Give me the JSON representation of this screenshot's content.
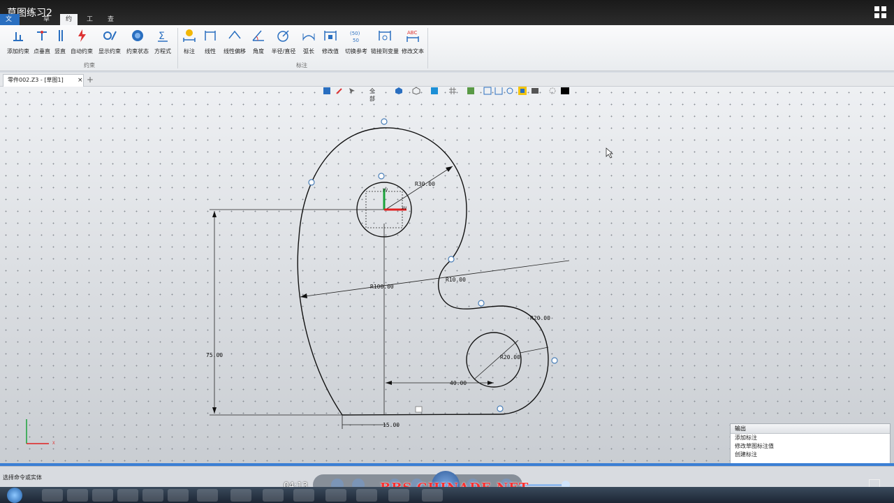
{
  "window": {
    "title": "草图练习2"
  },
  "ribbon_tabs": [
    {
      "label": "文件(F)"
    },
    {
      "label": "草图"
    },
    {
      "label": "约束"
    },
    {
      "label": "工具"
    },
    {
      "label": "查询"
    }
  ],
  "ribbon_buttons": [
    {
      "label": "添加约束",
      "icon": "add-constraint-icon"
    },
    {
      "label": "点垂直",
      "icon": "point-perpendicular-icon"
    },
    {
      "label": "竖直",
      "icon": "vertical-icon"
    },
    {
      "label": "自动约束",
      "icon": "auto-constraint-icon"
    },
    {
      "label": "显示约束",
      "icon": "show-constraint-icon"
    },
    {
      "label": "约束状态",
      "icon": "constraint-status-icon"
    },
    {
      "label": "方程式",
      "icon": "equation-icon"
    },
    {
      "label": "标注",
      "icon": "dimension-icon"
    },
    {
      "label": "线性",
      "icon": "linear-icon"
    },
    {
      "label": "线性偏移",
      "icon": "linear-offset-icon"
    },
    {
      "label": "角度",
      "icon": "angle-icon"
    },
    {
      "label": "半径/直径",
      "icon": "radius-diameter-icon"
    },
    {
      "label": "弧长",
      "icon": "arc-length-icon"
    },
    {
      "label": "修改值",
      "icon": "modify-value-icon"
    },
    {
      "label": "切换参考",
      "icon": "toggle-reference-icon"
    },
    {
      "label": "链接到变量",
      "icon": "link-variable-icon"
    },
    {
      "label": "修改文本",
      "icon": "modify-text-icon"
    }
  ],
  "ribbon_groups": [
    {
      "label": "约束"
    },
    {
      "label": "标注"
    }
  ],
  "document_tab": {
    "label": "零件002.Z3 - [草图1]",
    "close": "×"
  },
  "view_toolbar": {
    "filter_label": "全部"
  },
  "sketch": {
    "dimensions": {
      "r30": "R30.00",
      "r100": "R100.00",
      "r10": "R10.00",
      "r20_outer": "R20.00",
      "r20_inner": "R20.00",
      "d75": "75.00",
      "d40": "40.00",
      "d15": "15.00"
    },
    "axis_labels": {
      "xv": "XV",
      "yv": "YV",
      "x": "X"
    }
  },
  "output_panel": {
    "title": "输出",
    "lines": [
      "添加标注",
      "修改草图标注值",
      "",
      "创建标注"
    ]
  },
  "status": {
    "text": "选择命令或实体"
  },
  "player": {
    "time": "04:13"
  },
  "watermark": {
    "text": "BBS.CHINADE.NET"
  },
  "colors": {
    "accent": "#2a6fc0",
    "progress": "#3b7fd4",
    "watermark": "#ff3030"
  }
}
